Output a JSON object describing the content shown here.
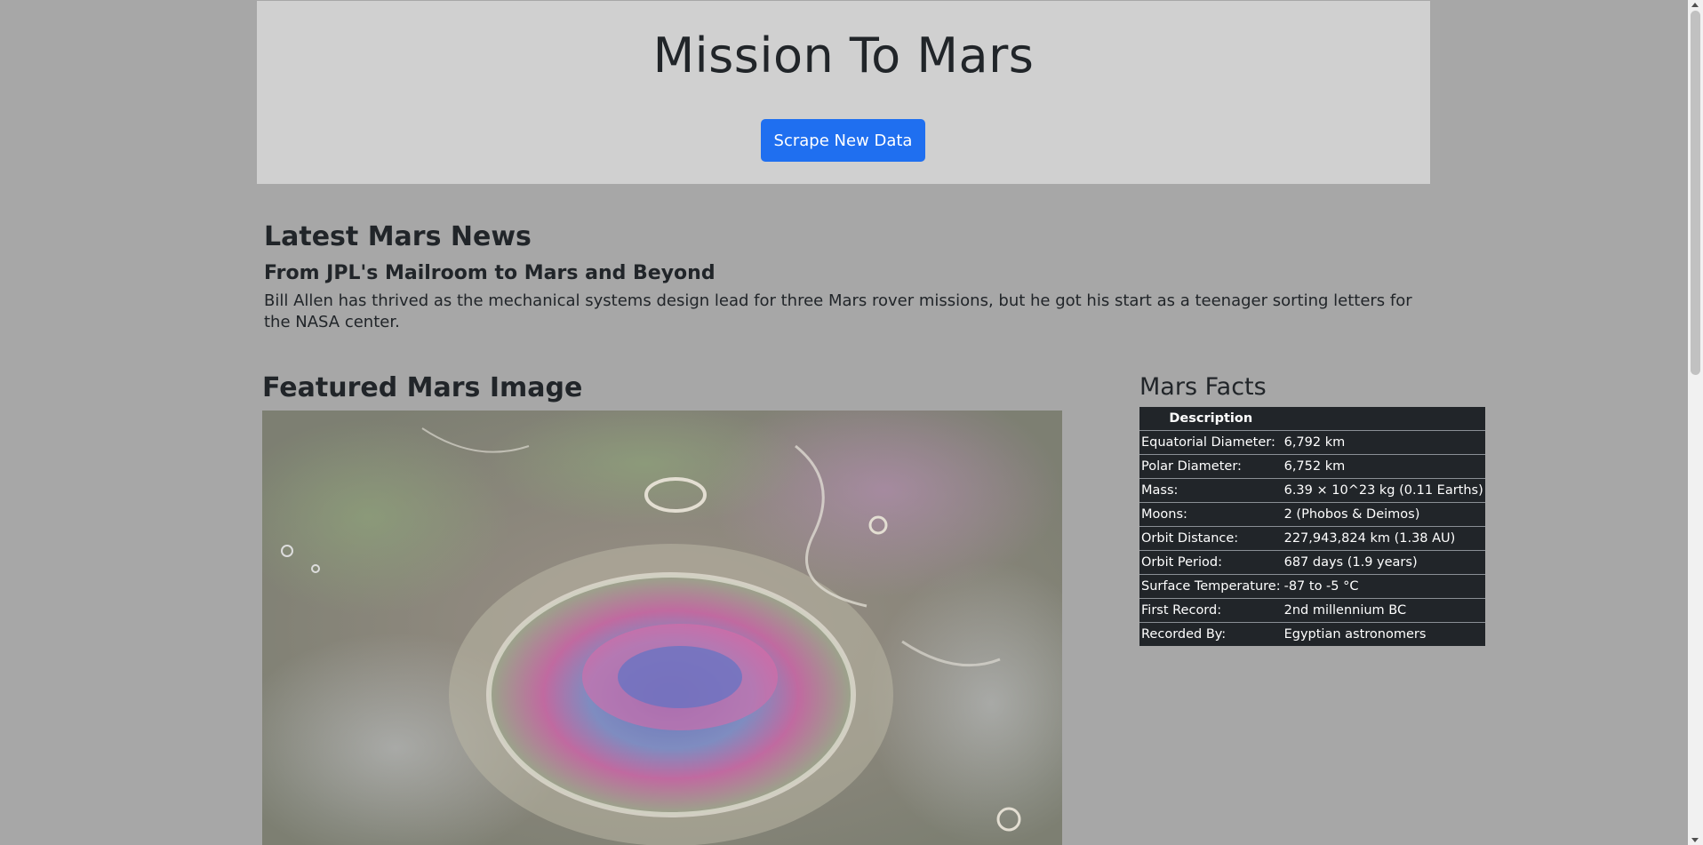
{
  "header": {
    "title": "Mission To Mars",
    "scrape_button": "Scrape New Data"
  },
  "news": {
    "section_title": "Latest Mars News",
    "headline": "From JPL's Mailroom to Mars and Beyond",
    "teaser": "Bill Allen has thrived as the mechanical systems design lead for three Mars rover missions, but he got his start as a teenager sorting letters for the NASA center."
  },
  "featured": {
    "section_title": "Featured Mars Image",
    "image_subject": "mars-crater-image"
  },
  "facts": {
    "section_title": "Mars Facts",
    "header": "Description",
    "rows": [
      {
        "label": "Equatorial Diameter:",
        "value": "6,792 km"
      },
      {
        "label": "Polar Diameter:",
        "value": "6,752 km"
      },
      {
        "label": "Mass:",
        "value": "6.39 × 10^23 kg (0.11 Earths)"
      },
      {
        "label": "Moons:",
        "value": "2 (Phobos & Deimos)"
      },
      {
        "label": "Orbit Distance:",
        "value": "227,943,824 km (1.38 AU)"
      },
      {
        "label": "Orbit Period:",
        "value": "687 days (1.9 years)"
      },
      {
        "label": "Surface Temperature:",
        "value": "-87 to -5 °C"
      },
      {
        "label": "First Record:",
        "value": "2nd millennium BC"
      },
      {
        "label": "Recorded By:",
        "value": "Egyptian astronomers"
      }
    ]
  },
  "colors": {
    "page_bg": "#a7a7a7",
    "jumbotron_bg": "#d0d0d0",
    "button_bg": "#1f6ff0",
    "table_bg": "#212529"
  }
}
